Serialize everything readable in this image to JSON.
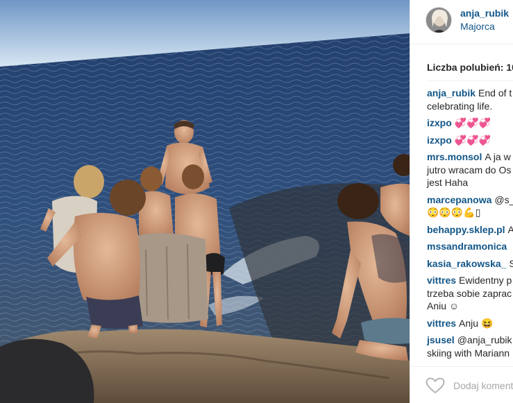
{
  "post": {
    "username": "anja_rubik",
    "location": "Majorca",
    "likes_text": "Liczba polubień: 10",
    "add_comment_placeholder": "Dodaj komentarz"
  },
  "comments": [
    {
      "user": "anja_rubik",
      "lines": [
        "End of t",
        "celebrating life."
      ]
    },
    {
      "user": "izxpo",
      "lines": [
        "💞💞💞"
      ]
    },
    {
      "user": "izxpo",
      "lines": [
        "💞💞💞"
      ]
    },
    {
      "user": "mrs.monsol",
      "lines": [
        "A ja w",
        "jutro wracam do Os",
        "jest Haha"
      ]
    },
    {
      "user": "marcepanowa",
      "lines": [
        "@s_",
        "😳😳😳💪▯"
      ]
    },
    {
      "user": "behappy.sklep.pl",
      "lines": [
        "A"
      ]
    },
    {
      "user": "mssandramonica",
      "lines": [
        "🕴"
      ]
    },
    {
      "user": "kasia_rakowska_",
      "lines": [
        "S"
      ]
    },
    {
      "user": "vittres",
      "lines": [
        "Ewidentny p",
        "trzeba sobie zaprac",
        "Aniu ☺"
      ]
    },
    {
      "user": "vittres",
      "lines": [
        "Anju 😆"
      ]
    },
    {
      "user": "jsusel",
      "lines": [
        "@anja_rubik",
        "skiing with Mariann"
      ]
    }
  ],
  "icons": {
    "like": "heart-outline-icon",
    "avatar": "profile-avatar"
  }
}
